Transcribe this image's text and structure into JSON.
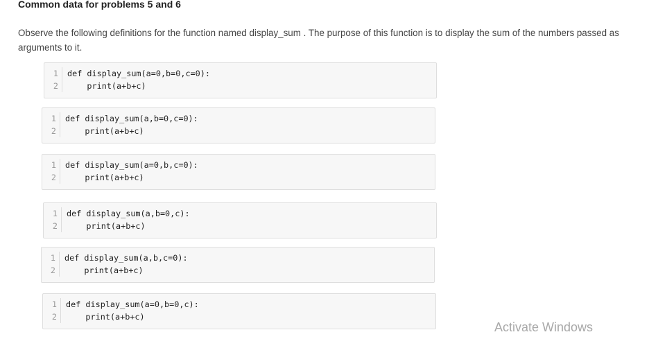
{
  "heading": "Common data for problems 5 and 6",
  "description": "Observe the following definitions for the function named display_sum . The purpose of this function is to display the sum of the numbers passed as arguments to it.",
  "code_blocks": [
    {
      "lines": [
        {
          "num": "1",
          "code": "def display_sum(a=0,b=0,c=0):"
        },
        {
          "num": "2",
          "code": "    print(a+b+c)"
        }
      ]
    },
    {
      "lines": [
        {
          "num": "1",
          "code": "def display_sum(a,b=0,c=0):"
        },
        {
          "num": "2",
          "code": "    print(a+b+c)"
        }
      ]
    },
    {
      "lines": [
        {
          "num": "1",
          "code": "def display_sum(a=0,b,c=0):"
        },
        {
          "num": "2",
          "code": "    print(a+b+c)"
        }
      ]
    },
    {
      "lines": [
        {
          "num": "1",
          "code": "def display_sum(a,b=0,c):"
        },
        {
          "num": "2",
          "code": "    print(a+b+c)"
        }
      ]
    },
    {
      "lines": [
        {
          "num": "1",
          "code": "def display_sum(a,b,c=0):"
        },
        {
          "num": "2",
          "code": "    print(a+b+c)"
        }
      ]
    },
    {
      "lines": [
        {
          "num": "1",
          "code": "def display_sum(a=0,b=0,c):"
        },
        {
          "num": "2",
          "code": "    print(a+b+c)"
        }
      ]
    }
  ],
  "watermark": "Activate Windows"
}
